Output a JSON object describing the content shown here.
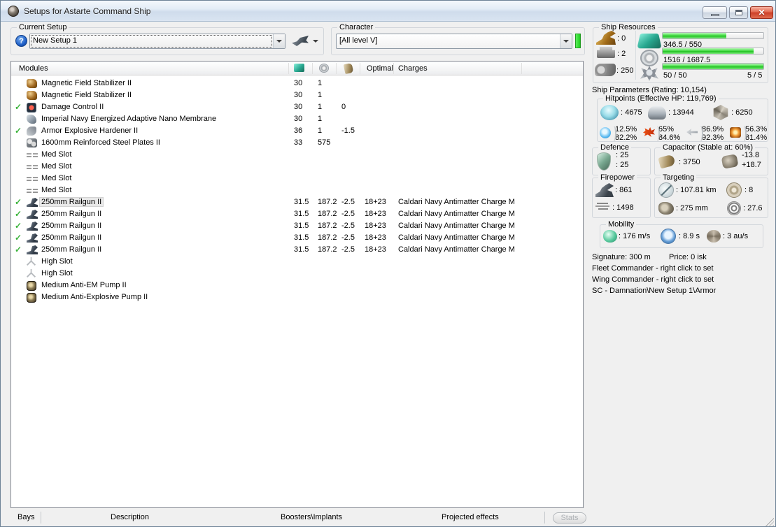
{
  "window": {
    "title": "Setups for Astarte Command Ship"
  },
  "setup_group": {
    "label": "Current Setup",
    "combo_value": "New Setup 1",
    "help_glyph": "?"
  },
  "character_group": {
    "label": "Character",
    "combo_value": "[All level V]"
  },
  "ship_resources": {
    "label": "Ship Resources",
    "turrets": ": 0",
    "launchers": ": 2",
    "calibration": ": 250",
    "cpu": {
      "text": "346.5 / 550",
      "pct": 63
    },
    "powergrid": {
      "text": "1516 / 1687.5",
      "pct": 90
    },
    "upgrade": {
      "text": "50 / 50",
      "right_text": "5 / 5",
      "pct": 100
    }
  },
  "modules_table": {
    "header": {
      "modules": "Modules",
      "optimal": "Optimal",
      "charges": "Charges"
    },
    "rows": [
      {
        "check": "",
        "state": "",
        "icon": "magstab",
        "name": "Magnetic Field Stabilizer II",
        "cpu": "30",
        "pg": "1",
        "cap": "",
        "optimal": "",
        "charges": ""
      },
      {
        "check": "",
        "state": "",
        "icon": "magstab",
        "name": "Magnetic Field Stabilizer II",
        "cpu": "30",
        "pg": "1",
        "cap": "",
        "optimal": "",
        "charges": ""
      },
      {
        "check": "✓",
        "state": "",
        "icon": "damagecontrol",
        "name": "Damage Control II",
        "cpu": "30",
        "pg": "1",
        "cap": "0",
        "optimal": "",
        "charges": ""
      },
      {
        "check": "",
        "state": "",
        "icon": "membrane",
        "name": "Imperial Navy Energized Adaptive Nano Membrane",
        "cpu": "30",
        "pg": "1",
        "cap": "",
        "optimal": "",
        "charges": ""
      },
      {
        "check": "✓",
        "state": "",
        "icon": "hardener",
        "name": "Armor Explosive Hardener II",
        "cpu": "36",
        "pg": "1",
        "cap": "-1.5",
        "optimal": "",
        "charges": ""
      },
      {
        "check": "",
        "state": "",
        "icon": "plates",
        "name": "1600mm Reinforced Steel Plates II",
        "cpu": "33",
        "pg": "575",
        "cap": "",
        "optimal": "",
        "charges": ""
      },
      {
        "check": "",
        "state": "",
        "icon": "medslot",
        "name": "Med Slot",
        "cpu": "",
        "pg": "",
        "cap": "",
        "optimal": "",
        "charges": ""
      },
      {
        "check": "",
        "state": "",
        "icon": "medslot",
        "name": "Med Slot",
        "cpu": "",
        "pg": "",
        "cap": "",
        "optimal": "",
        "charges": ""
      },
      {
        "check": "",
        "state": "",
        "icon": "medslot",
        "name": "Med Slot",
        "cpu": "",
        "pg": "",
        "cap": "",
        "optimal": "",
        "charges": ""
      },
      {
        "check": "",
        "state": "",
        "icon": "medslot",
        "name": "Med Slot",
        "cpu": "",
        "pg": "",
        "cap": "",
        "optimal": "",
        "charges": ""
      },
      {
        "check": "✓",
        "state": "selected",
        "icon": "railgun",
        "name": "250mm Railgun II",
        "cpu": "31.5",
        "pg": "187.2",
        "cap": "-2.5",
        "optimal": "18+23",
        "charges": "Caldari Navy Antimatter Charge M"
      },
      {
        "check": "✓",
        "state": "",
        "icon": "railgun",
        "name": "250mm Railgun II",
        "cpu": "31.5",
        "pg": "187.2",
        "cap": "-2.5",
        "optimal": "18+23",
        "charges": "Caldari Navy Antimatter Charge M"
      },
      {
        "check": "✓",
        "state": "",
        "icon": "railgun",
        "name": "250mm Railgun II",
        "cpu": "31.5",
        "pg": "187.2",
        "cap": "-2.5",
        "optimal": "18+23",
        "charges": "Caldari Navy Antimatter Charge M"
      },
      {
        "check": "✓",
        "state": "",
        "icon": "railgun",
        "name": "250mm Railgun II",
        "cpu": "31.5",
        "pg": "187.2",
        "cap": "-2.5",
        "optimal": "18+23",
        "charges": "Caldari Navy Antimatter Charge M"
      },
      {
        "check": "✓",
        "state": "",
        "icon": "railgun",
        "name": "250mm Railgun II",
        "cpu": "31.5",
        "pg": "187.2",
        "cap": "-2.5",
        "optimal": "18+23",
        "charges": "Caldari Navy Antimatter Charge M"
      },
      {
        "check": "",
        "state": "",
        "icon": "highslot",
        "name": "High Slot",
        "cpu": "",
        "pg": "",
        "cap": "",
        "optimal": "",
        "charges": ""
      },
      {
        "check": "",
        "state": "",
        "icon": "highslot",
        "name": "High Slot",
        "cpu": "",
        "pg": "",
        "cap": "",
        "optimal": "",
        "charges": ""
      },
      {
        "check": "",
        "state": "",
        "icon": "pump",
        "name": "Medium Anti-EM Pump II",
        "cpu": "",
        "pg": "",
        "cap": "",
        "optimal": "",
        "charges": ""
      },
      {
        "check": "",
        "state": "",
        "icon": "pump",
        "name": "Medium Anti-Explosive Pump II",
        "cpu": "",
        "pg": "",
        "cap": "",
        "optimal": "",
        "charges": ""
      }
    ]
  },
  "ship_parameters": {
    "title": "Ship Parameters (Rating: 10,154)",
    "hitpoints": {
      "label": "Hitpoints (Effective HP: 119,769)",
      "shield": ": 4675",
      "armor": ": 13944",
      "hull": ": 6250",
      "resists": [
        {
          "type": "em",
          "top": "12.5%",
          "bottom": "82.2%"
        },
        {
          "type": "thermal",
          "top": "65%",
          "bottom": "84.6%"
        },
        {
          "type": "kinetic",
          "top": "86.9%",
          "bottom": "92.3%"
        },
        {
          "type": "explosive",
          "top": "56.3%",
          "bottom": "81.4%"
        }
      ]
    },
    "defence": {
      "label": "Defence",
      "value1": ": 25",
      "value2": ": 25"
    },
    "capacitor": {
      "label": "Capacitor (Stable at: 60%)",
      "capacity": ": 3750",
      "peak_minus": "-13.8",
      "peak_plus": "+18.7"
    },
    "firepower": {
      "label": "Firepower",
      "turret_dps": ": 861",
      "volley": ": 1498"
    },
    "targeting": {
      "label": "Targeting",
      "range": ": 107.81 km",
      "max_targets": ": 8",
      "scan_res": ": 275 mm",
      "sensor_str": ": 27.6"
    },
    "mobility": {
      "label": "Mobility",
      "speed": ": 176 m/s",
      "agility": ": 8.9 s",
      "warp": ": 3 au/s"
    },
    "info": {
      "signature": "Signature: 300 m",
      "price": "Price: 0 isk",
      "fleet": "Fleet Commander - right click to set",
      "wing": "Wing Commander - right click to set",
      "sc": "SC - Damnation\\New Setup 1\\Armor"
    }
  },
  "bottom_bar": {
    "tabs": [
      "Bays",
      "Description",
      "Boosters\\Implants",
      "Projected effects"
    ],
    "stats_label": "Stats"
  }
}
